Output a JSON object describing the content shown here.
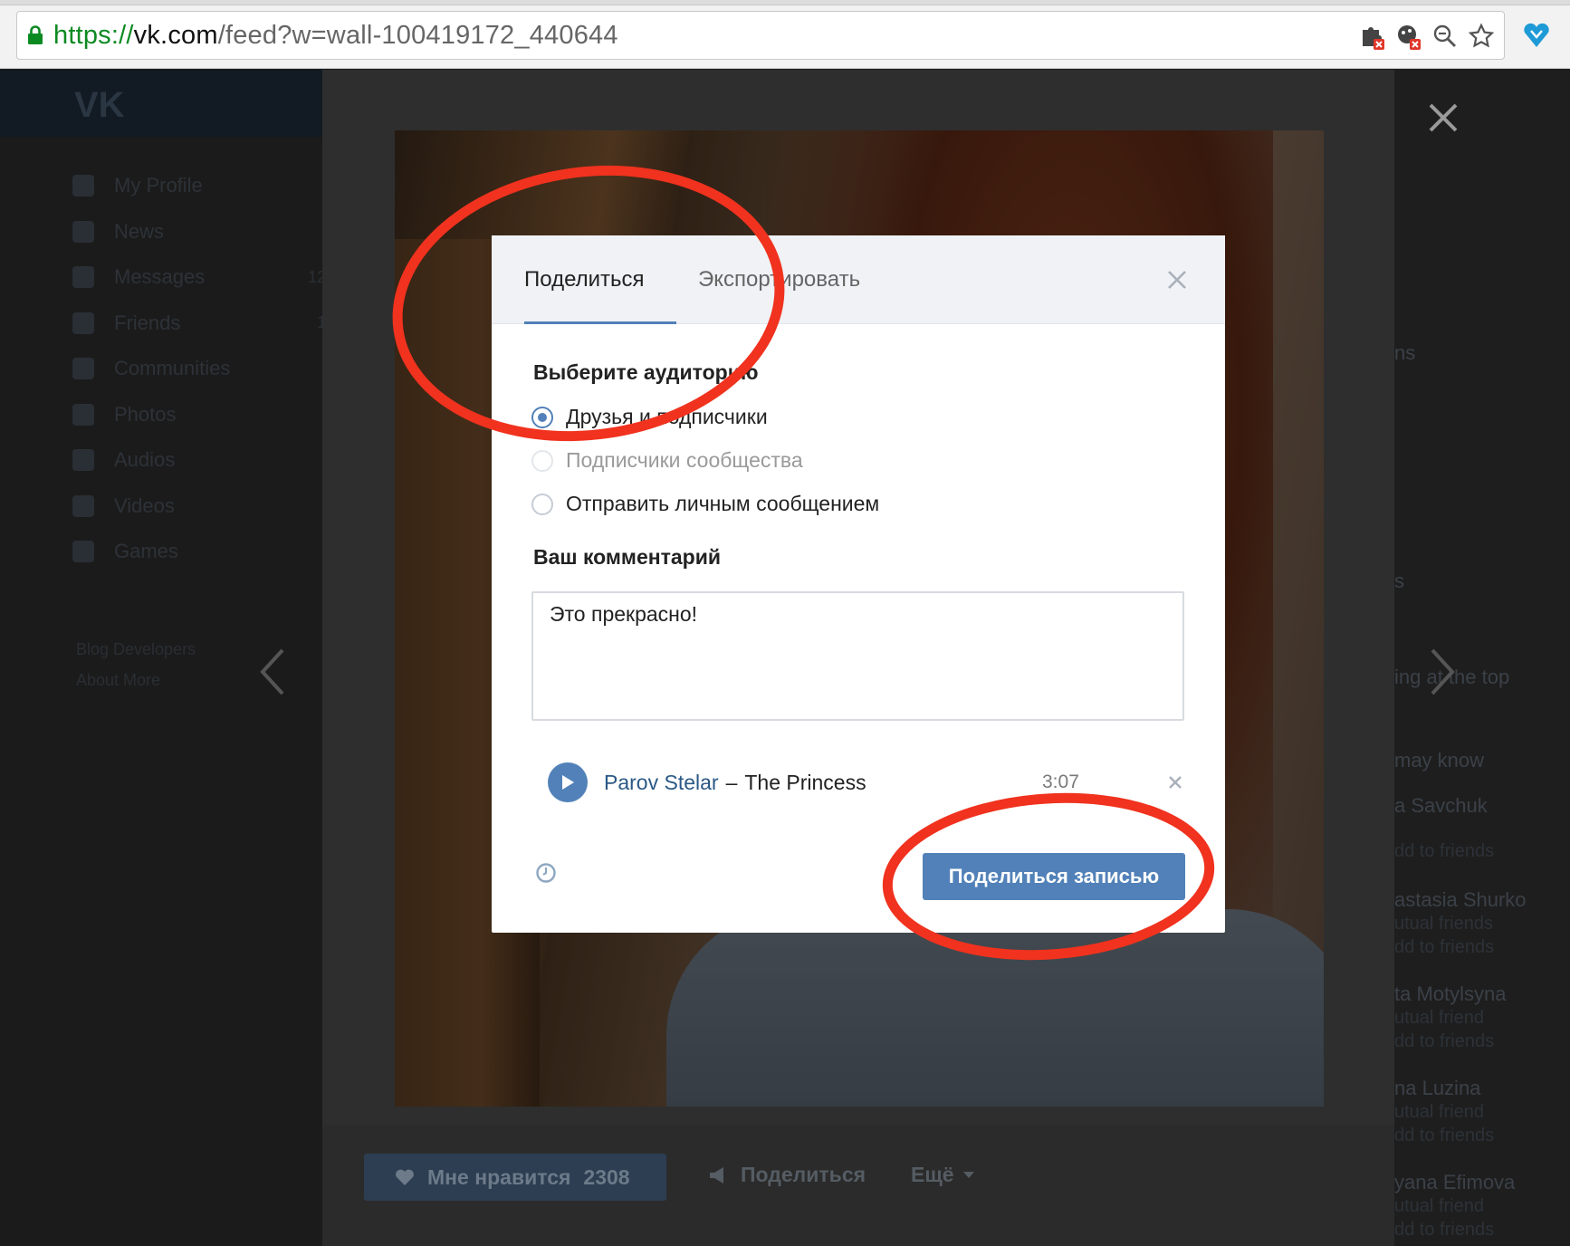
{
  "browser": {
    "url_scheme": "https://",
    "url_domain": "vk.com",
    "url_path": "/feed?w=wall-100419172_440644",
    "icons": [
      "lock-icon",
      "extension-blocked-icon",
      "extension-blocked-icon",
      "zoom-icon",
      "bookmark-star-icon",
      "extension-heart-icon"
    ]
  },
  "vk_page": {
    "logo": "VK",
    "nav": [
      {
        "label": "My Profile",
        "count": ""
      },
      {
        "label": "News",
        "count": ""
      },
      {
        "label": "Messages",
        "count": "12"
      },
      {
        "label": "Friends",
        "count": "1"
      },
      {
        "label": "Communities",
        "count": ""
      },
      {
        "label": "Photos",
        "count": ""
      },
      {
        "label": "Audios",
        "count": ""
      },
      {
        "label": "Videos",
        "count": ""
      },
      {
        "label": "Games",
        "count": ""
      }
    ],
    "footer_line1": "Blog   Developers",
    "footer_line2": "About   More",
    "right": {
      "r1": "ns",
      "r2": "s",
      "r3": "ing at the top",
      "r4": "may know",
      "r5": "a Savchuk",
      "r6": "dd to friends",
      "r7": "astasia Shurko",
      "r8": "utual friends",
      "r9": "dd to friends",
      "r10": "ta Motylsyna",
      "r11": "utual friend",
      "r12": "dd to friends",
      "r13": "na Luzina",
      "r14": "utual friend",
      "r15": "dd to friends",
      "r16": "yana Efimova",
      "r17": "utual friend",
      "r18": "dd to friends"
    },
    "actions": {
      "like_label": "Мне нравится",
      "like_count": "2308",
      "share_label": "Поделиться",
      "more_label": "Ещё"
    }
  },
  "modal": {
    "tabs": [
      "Поделиться",
      "Экспортировать"
    ],
    "audience_title": "Выберите аудиторию",
    "options": [
      {
        "label": "Друзья и подписчики",
        "selected": true,
        "disabled": false
      },
      {
        "label": "Подписчики сообщества",
        "selected": false,
        "disabled": true
      },
      {
        "label": "Отправить личным сообщением",
        "selected": false,
        "disabled": false
      }
    ],
    "comment_title": "Ваш комментарий",
    "comment_value": "Это прекрасно!",
    "audio": {
      "artist": "Parov Stelar",
      "dash": "–",
      "title": "The Princess",
      "duration": "3:07"
    },
    "submit_label": "Поделиться записью"
  },
  "colors": {
    "accent": "#5181b8",
    "link": "#2a5885",
    "annotation": "#f0321e"
  }
}
